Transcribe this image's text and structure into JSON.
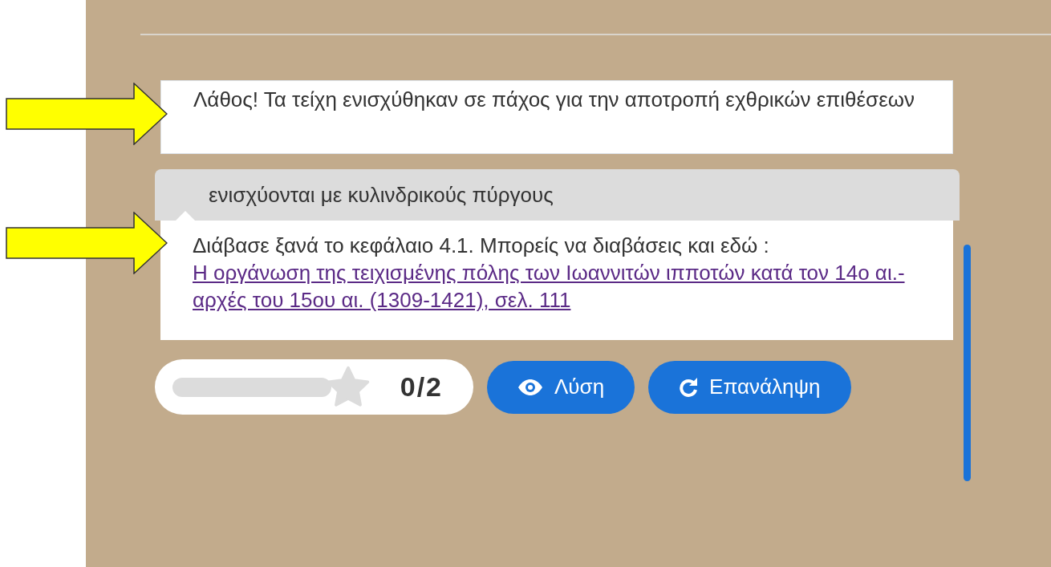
{
  "feedback": {
    "text": "Λάθος! Τα τείχη ενισχύθηκαν σε πάχος για την αποτροπή εχθρικών επιθέσεων"
  },
  "chosen_answer": {
    "text": "ενισχύονται με κυλινδρικούς πύργους"
  },
  "hint": {
    "text": "Διάβασε ξανά το κεφάλαιο 4.1. Μπορείς να διαβάσεις και εδώ :",
    "link": "Η οργάνωση της τειχισμένης πόλης των Ιωαννιτών ιπποτών κατά τον 14ο αι.- αρχές του 15ου αι. (1309-1421), σελ. 111"
  },
  "score": {
    "level": 0,
    "text": "0/2"
  },
  "buttons": [
    {
      "kind": "solution",
      "label": "Λύση"
    },
    {
      "kind": "retry",
      "label": "Επανάληψη"
    }
  ]
}
